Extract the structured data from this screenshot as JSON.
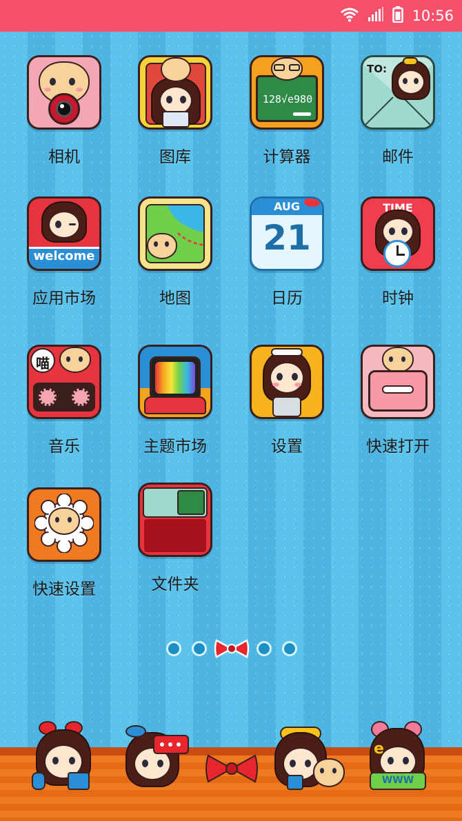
{
  "status_bar": {
    "time": "10:56",
    "wifi_icon": "wifi-icon",
    "signal_icon": "signal-icon",
    "battery_icon": "battery-icon",
    "bg_color": "#f5516b"
  },
  "apps": [
    {
      "label": "相机",
      "icon": "camera-icon",
      "bg": "#f3a6b5"
    },
    {
      "label": "图库",
      "icon": "gallery-icon",
      "bg": "#f7d33a"
    },
    {
      "label": "计算器",
      "icon": "calculator-icon",
      "bg": "#2e8b47",
      "board_text": "128√e980"
    },
    {
      "label": "邮件",
      "icon": "mail-icon",
      "bg": "#bfe7de",
      "envelope_text": "TO:"
    },
    {
      "label": "应用市场",
      "icon": "app-market-icon",
      "bg": "#e7343f",
      "banner_text": "welcome"
    },
    {
      "label": "地图",
      "icon": "map-icon",
      "bg": "#f5e38c"
    },
    {
      "label": "日历",
      "icon": "calendar-icon",
      "bg": "#e6f6ff",
      "month": "AUG",
      "day": "21"
    },
    {
      "label": "时钟",
      "icon": "clock-icon",
      "bg": "#f03e4e",
      "banner_text": "TIME"
    },
    {
      "label": "音乐",
      "icon": "music-icon",
      "bg": "#e8343f",
      "badge_text": "喵"
    },
    {
      "label": "主题市场",
      "icon": "theme-market-icon",
      "bg": "#f5a41f"
    },
    {
      "label": "设置",
      "icon": "settings-icon",
      "bg": "#f6b31c"
    },
    {
      "label": "快速打开",
      "icon": "quick-open-icon",
      "bg": "#f7b9c0"
    },
    {
      "label": "快速设置",
      "icon": "quick-settings-icon",
      "bg": "#f07a22"
    },
    {
      "label": "文件夹",
      "icon": "folder-icon",
      "bg": "#e8343f"
    }
  ],
  "pager": {
    "pages": 5,
    "current": 3,
    "current_icon": "bow-icon"
  },
  "dock": [
    {
      "name": "dock-phone",
      "icon": "phone-icon"
    },
    {
      "name": "dock-messages",
      "icon": "messages-icon"
    },
    {
      "name": "dock-bow",
      "icon": "bow-icon"
    },
    {
      "name": "dock-contacts",
      "icon": "contacts-icon"
    },
    {
      "name": "dock-browser",
      "icon": "browser-icon",
      "sign_text": "WWW"
    }
  ]
}
